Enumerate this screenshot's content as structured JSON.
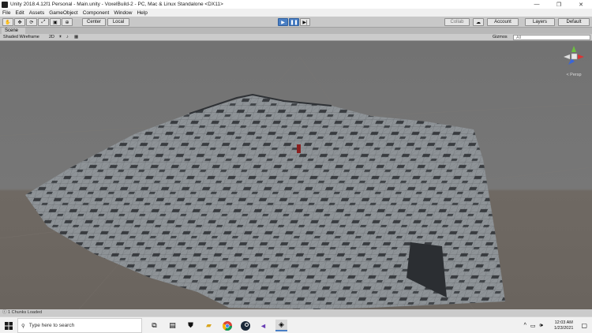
{
  "window": {
    "title": "Unity 2018.4.12f1 Personal - Main.unity - VoxelBuild-2 - PC, Mac & Linux Standalone <DX11>",
    "controls": [
      "—",
      "❐",
      "✕"
    ]
  },
  "menu": [
    "File",
    "Edit",
    "Assets",
    "GameObject",
    "Component",
    "Window",
    "Help"
  ],
  "toolbar": {
    "pivot_label": "Center",
    "space_label": "Local",
    "collab_label": "Collab",
    "account_label": "Account",
    "layers_label": "Layers",
    "layout_label": "Default"
  },
  "scene": {
    "tab_label": "Scene",
    "shading_mode": "Shaded Wireframe",
    "mode_2d": "2D",
    "gizmos_label": "Gizmos",
    "search_placeholder": "All",
    "persp_label": "< Persp"
  },
  "status": {
    "message": "1 Chunks Loaded"
  },
  "taskbar": {
    "search_placeholder": "Type here to search",
    "time": "12:03 AM",
    "date": "1/23/2021"
  },
  "colors": {
    "sky": "#7d7d7d",
    "ground": "#6e6862",
    "terrain": "#8b9094",
    "accent": "#4a7fc4"
  }
}
